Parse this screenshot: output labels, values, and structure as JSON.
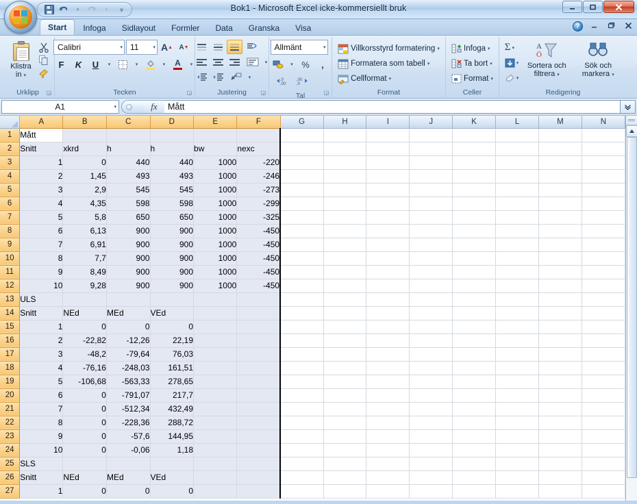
{
  "window": {
    "title": "Bok1 - Microsoft Excel icke-kommersiellt bruk",
    "minimize_label": "–",
    "restore_label": "❐",
    "close_label": "✕"
  },
  "quick_access": {
    "save_label": "save-icon",
    "undo_label": "↶",
    "redo_label": "↷",
    "customize_label": "⌄"
  },
  "tabs": [
    {
      "label": "Start",
      "active": true
    },
    {
      "label": "Infoga",
      "active": false
    },
    {
      "label": "Sidlayout",
      "active": false
    },
    {
      "label": "Formler",
      "active": false
    },
    {
      "label": "Data",
      "active": false
    },
    {
      "label": "Granska",
      "active": false
    },
    {
      "label": "Visa",
      "active": false
    }
  ],
  "tab_right": {
    "help_label": "?",
    "minimize_label": "–",
    "restore_label": "❐",
    "close_label": "✕"
  },
  "ribbon": {
    "clipboard": {
      "group_label": "Urklipp",
      "paste_label": "Klistra\nin",
      "paste_caret": "▾",
      "cut_label": "cut-icon",
      "copy_label": "copy-icon",
      "format_painter_label": "format-painter-icon",
      "dialog_launcher": "⬌"
    },
    "font": {
      "group_label": "Tecken",
      "font_name": "Calibri",
      "font_size": "11",
      "grow_font_label": "A",
      "shrink_font_label": "A",
      "bold_label": "F",
      "italic_label": "K",
      "underline_label": "U",
      "borders_label": "borders-icon",
      "fill_color_label": "A",
      "font_color_label": "A",
      "caret": "▾",
      "dialog_launcher": "⬌"
    },
    "alignment": {
      "group_label": "Justering",
      "top_align_label": "align-top-icon",
      "middle_align_label": "align-middle-icon",
      "bottom_align_label": "align-bottom-icon",
      "orientation_label": "orientation-icon",
      "align_left_label": "align-left-icon",
      "align_center_label": "align-center-icon",
      "align_right_label": "align-right-icon",
      "wrap_text_label": "wrap-text-icon",
      "decrease_indent_label": "decrease-indent-icon",
      "increase_indent_label": "increase-indent-icon",
      "merge_label": "merge-cells-icon",
      "caret": "▾",
      "dialog_launcher": "⬌"
    },
    "number": {
      "group_label": "Tal",
      "format_value": "Allmänt",
      "currency_label": "currency-icon",
      "percent_label": "%",
      "comma_label": "‚",
      "increase_decimal_label": ",00",
      "decrease_decimal_label": ",00",
      "caret": "▾",
      "dialog_launcher": "⬌"
    },
    "styles": {
      "group_label": "Format",
      "conditional_label": "Villkorsstyrd formatering",
      "table_label": "Formatera som tabell",
      "cellstyle_label": "Cellformat",
      "caret": "▾"
    },
    "cells": {
      "group_label": "Celler",
      "insert_label": "Infoga",
      "delete_label": "Ta bort",
      "format_label": "Format",
      "caret": "▾"
    },
    "editing": {
      "group_label": "Redigering",
      "autosum_label": "Σ",
      "fill_label": "fill-icon",
      "clear_label": "clear-icon",
      "sort_filter_label": "Sortera och\nfiltrera",
      "find_select_label": "Sök och\nmarkera",
      "caret": "▾"
    }
  },
  "formula_bar": {
    "name_box_value": "A1",
    "name_box_caret": "▾",
    "fx_label": "fx",
    "cell_content": "Mått",
    "expand_label": "˅"
  },
  "grid": {
    "select_all_label": "select-all-corner",
    "columns": [
      {
        "label": "A",
        "width": 64,
        "highlighted": true
      },
      {
        "label": "B",
        "width": 64,
        "highlighted": true
      },
      {
        "label": "C",
        "width": 64,
        "highlighted": true
      },
      {
        "label": "D",
        "width": 64,
        "highlighted": true
      },
      {
        "label": "E",
        "width": 64,
        "highlighted": true
      },
      {
        "label": "F",
        "width": 64,
        "highlighted": true
      },
      {
        "label": "G",
        "width": 64,
        "highlighted": false
      },
      {
        "label": "H",
        "width": 64,
        "highlighted": false
      },
      {
        "label": "I",
        "width": 64,
        "highlighted": false
      },
      {
        "label": "J",
        "width": 64,
        "highlighted": false
      },
      {
        "label": "K",
        "width": 64,
        "highlighted": false
      },
      {
        "label": "L",
        "width": 64,
        "highlighted": false
      },
      {
        "label": "M",
        "width": 64,
        "highlighted": false
      },
      {
        "label": "N",
        "width": 64,
        "highlighted": false
      }
    ],
    "selection_range": "A1:F27",
    "active_cell": "A1",
    "rows": [
      {
        "num": "1",
        "cells": [
          "Mått",
          "",
          "",
          "",
          "",
          ""
        ],
        "align": [
          "txt",
          "txt",
          "txt",
          "txt",
          "txt",
          "txt"
        ]
      },
      {
        "num": "2",
        "cells": [
          "Snitt",
          "xkrd",
          "h",
          "h",
          "bw",
          "nexc"
        ],
        "align": [
          "txt",
          "txt",
          "txt",
          "txt",
          "txt",
          "txt"
        ]
      },
      {
        "num": "3",
        "cells": [
          "1",
          "0",
          "440",
          "440",
          "1000",
          "-220"
        ],
        "align": [
          "num",
          "num",
          "num",
          "num",
          "num",
          "num"
        ]
      },
      {
        "num": "4",
        "cells": [
          "2",
          "1,45",
          "493",
          "493",
          "1000",
          "-246"
        ],
        "align": [
          "num",
          "num",
          "num",
          "num",
          "num",
          "num"
        ]
      },
      {
        "num": "5",
        "cells": [
          "3",
          "2,9",
          "545",
          "545",
          "1000",
          "-273"
        ],
        "align": [
          "num",
          "num",
          "num",
          "num",
          "num",
          "num"
        ]
      },
      {
        "num": "6",
        "cells": [
          "4",
          "4,35",
          "598",
          "598",
          "1000",
          "-299"
        ],
        "align": [
          "num",
          "num",
          "num",
          "num",
          "num",
          "num"
        ]
      },
      {
        "num": "7",
        "cells": [
          "5",
          "5,8",
          "650",
          "650",
          "1000",
          "-325"
        ],
        "align": [
          "num",
          "num",
          "num",
          "num",
          "num",
          "num"
        ]
      },
      {
        "num": "8",
        "cells": [
          "6",
          "6,13",
          "900",
          "900",
          "1000",
          "-450"
        ],
        "align": [
          "num",
          "num",
          "num",
          "num",
          "num",
          "num"
        ]
      },
      {
        "num": "9",
        "cells": [
          "7",
          "6,91",
          "900",
          "900",
          "1000",
          "-450"
        ],
        "align": [
          "num",
          "num",
          "num",
          "num",
          "num",
          "num"
        ]
      },
      {
        "num": "10",
        "cells": [
          "8",
          "7,7",
          "900",
          "900",
          "1000",
          "-450"
        ],
        "align": [
          "num",
          "num",
          "num",
          "num",
          "num",
          "num"
        ]
      },
      {
        "num": "11",
        "cells": [
          "9",
          "8,49",
          "900",
          "900",
          "1000",
          "-450"
        ],
        "align": [
          "num",
          "num",
          "num",
          "num",
          "num",
          "num"
        ]
      },
      {
        "num": "12",
        "cells": [
          "10",
          "9,28",
          "900",
          "900",
          "1000",
          "-450"
        ],
        "align": [
          "num",
          "num",
          "num",
          "num",
          "num",
          "num"
        ]
      },
      {
        "num": "13",
        "cells": [
          "ULS",
          "",
          "",
          "",
          "",
          ""
        ],
        "align": [
          "txt",
          "txt",
          "txt",
          "txt",
          "txt",
          "txt"
        ]
      },
      {
        "num": "14",
        "cells": [
          "Snitt",
          "NEd",
          "MEd",
          "VEd",
          "",
          ""
        ],
        "align": [
          "txt",
          "txt",
          "txt",
          "txt",
          "txt",
          "txt"
        ]
      },
      {
        "num": "15",
        "cells": [
          "1",
          "0",
          "0",
          "0",
          "",
          ""
        ],
        "align": [
          "num",
          "num",
          "num",
          "num",
          "num",
          "num"
        ]
      },
      {
        "num": "16",
        "cells": [
          "2",
          "-22,82",
          "-12,26",
          "22,19",
          "",
          ""
        ],
        "align": [
          "num",
          "num",
          "num",
          "num",
          "num",
          "num"
        ]
      },
      {
        "num": "17",
        "cells": [
          "3",
          "-48,2",
          "-79,64",
          "76,03",
          "",
          ""
        ],
        "align": [
          "num",
          "num",
          "num",
          "num",
          "num",
          "num"
        ]
      },
      {
        "num": "18",
        "cells": [
          "4",
          "-76,16",
          "-248,03",
          "161,51",
          "",
          ""
        ],
        "align": [
          "num",
          "num",
          "num",
          "num",
          "num",
          "num"
        ]
      },
      {
        "num": "19",
        "cells": [
          "5",
          "-106,68",
          "-563,33",
          "278,65",
          "",
          ""
        ],
        "align": [
          "num",
          "num",
          "num",
          "num",
          "num",
          "num"
        ]
      },
      {
        "num": "20",
        "cells": [
          "6",
          "0",
          "-791,07",
          "217,7",
          "",
          ""
        ],
        "align": [
          "num",
          "num",
          "num",
          "num",
          "num",
          "num"
        ]
      },
      {
        "num": "21",
        "cells": [
          "7",
          "0",
          "-512,34",
          "432,49",
          "",
          ""
        ],
        "align": [
          "num",
          "num",
          "num",
          "num",
          "num",
          "num"
        ]
      },
      {
        "num": "22",
        "cells": [
          "8",
          "0",
          "-228,36",
          "288,72",
          "",
          ""
        ],
        "align": [
          "num",
          "num",
          "num",
          "num",
          "num",
          "num"
        ]
      },
      {
        "num": "23",
        "cells": [
          "9",
          "0",
          "-57,6",
          "144,95",
          "",
          ""
        ],
        "align": [
          "num",
          "num",
          "num",
          "num",
          "num",
          "num"
        ]
      },
      {
        "num": "24",
        "cells": [
          "10",
          "0",
          "-0,06",
          "1,18",
          "",
          ""
        ],
        "align": [
          "num",
          "num",
          "num",
          "num",
          "num",
          "num"
        ]
      },
      {
        "num": "25",
        "cells": [
          "SLS",
          "",
          "",
          "",
          "",
          ""
        ],
        "align": [
          "txt",
          "txt",
          "txt",
          "txt",
          "txt",
          "txt"
        ]
      },
      {
        "num": "26",
        "cells": [
          "Snitt",
          "NEd",
          "MEd",
          "VEd",
          "",
          ""
        ],
        "align": [
          "txt",
          "txt",
          "txt",
          "txt",
          "txt",
          "txt"
        ]
      },
      {
        "num": "27",
        "cells": [
          "1",
          "0",
          "0",
          "0",
          "",
          ""
        ],
        "align": [
          "num",
          "num",
          "num",
          "num",
          "num",
          "num"
        ]
      }
    ]
  },
  "scrollbar": {
    "split_label": "split-handle",
    "up_arrow_label": "▲"
  },
  "colors": {
    "highlight_header": "#fbd592",
    "selection_fill": "#e3e8f3",
    "selection_border": "#000000",
    "accent_blue": "#1a3c68"
  }
}
